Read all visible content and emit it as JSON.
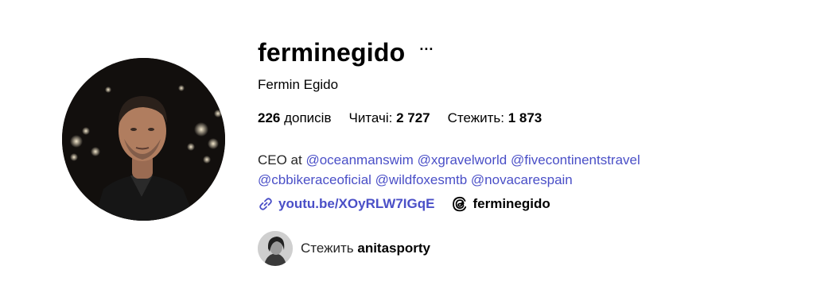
{
  "profile": {
    "username": "ferminegido",
    "more_label": "···",
    "full_name": "Fermin Egido",
    "avatar_icon": "profile-photo",
    "stats": [
      {
        "value": "226",
        "label": " дописів"
      },
      {
        "label": "Читачі: ",
        "value": "2 727"
      },
      {
        "label": "Стежить: ",
        "value": "1 873"
      }
    ],
    "bio": {
      "prefix": "CEO at ",
      "mentions": [
        "@oceanmanswim",
        "@xgravelworld",
        "@fivecontinentstravel",
        "@cbbikeraceoficial",
        "@wildfoxesmtb",
        "@novacarespain"
      ]
    },
    "link": {
      "icon": "link-icon",
      "text": "youtu.be/XOyRLW7IGqE"
    },
    "threads": {
      "icon": "threads-icon",
      "text": "ferminegido"
    },
    "followed_by": {
      "prefix": "Стежить ",
      "name": "anitasporty"
    }
  },
  "colors": {
    "link": "#4a4fc7",
    "text": "#000000",
    "muted": "#262626"
  }
}
